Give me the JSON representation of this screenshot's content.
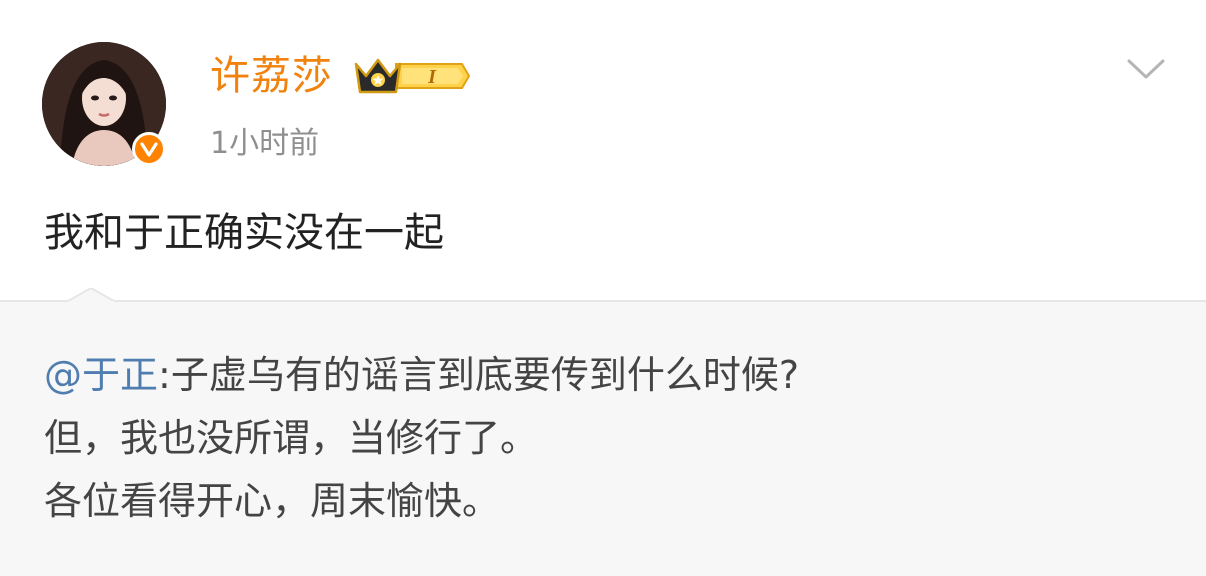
{
  "post": {
    "author": {
      "name": "许荔莎",
      "avatar_icon": "avatar-portrait",
      "verified_icon": "verified-v-icon",
      "crown_badge_icon": "crown-level-badge-icon",
      "crown_badge_text": "I"
    },
    "timestamp": "1小时前",
    "text": "我和于正确实没在一起"
  },
  "repost": {
    "mention": "@于正",
    "line1_rest": ":子虚乌有的谣言到底要传到什么时候?",
    "line2": "但，我也没所谓，当修行了。",
    "line3": "各位看得开心，周末愉快。"
  },
  "colors": {
    "username": "#f0820d",
    "mention": "#507daf",
    "verified": "#ff8200",
    "repost_bg": "#f7f7f7"
  }
}
